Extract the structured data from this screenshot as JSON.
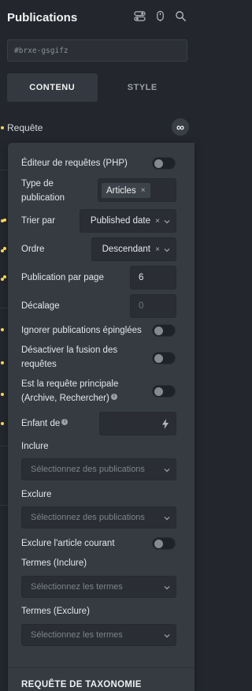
{
  "header": {
    "title": "Publications",
    "icons": [
      "toggle-icon",
      "mouse-pointer-icon",
      "search-icon"
    ]
  },
  "element_id": "#brxe-gsgifz",
  "tabs": [
    {
      "label": "CONTENU",
      "active": true
    },
    {
      "label": "STYLE",
      "active": false
    }
  ],
  "background": {
    "query_label": "Requête",
    "infinity_icon": "∞"
  },
  "panel": {
    "php_editor": {
      "label": "Éditeur de requêtes (PHP)",
      "enabled": false
    },
    "post_type": {
      "label": "Type de publication",
      "tags": [
        "Articles"
      ],
      "remove": "×"
    },
    "order_by": {
      "label": "Trier par",
      "value": "Published date",
      "clear": "×"
    },
    "order": {
      "label": "Ordre",
      "value": "Descendant",
      "clear": "×"
    },
    "per_page": {
      "label": "Publication par page",
      "value": "6"
    },
    "offset": {
      "label": "Décalage",
      "placeholder": "0"
    },
    "ignore_sticky": {
      "label": "Ignorer publications épinglées",
      "enabled": false
    },
    "disable_merge": {
      "label": "Désactiver la fusion des requêtes",
      "enabled": false
    },
    "main_query": {
      "label": "Est la requête principale (Archive, Rechercher)",
      "info": "i",
      "enabled": false
    },
    "child_of": {
      "label": "Enfant de",
      "info": "i"
    },
    "include": {
      "label": "Inclure",
      "placeholder": "Sélectionnez des publications"
    },
    "exclude": {
      "label": "Exclure",
      "placeholder": "Sélectionnez des publications"
    },
    "exclude_current": {
      "label": "Exclure l'article courant",
      "enabled": false
    },
    "terms_include": {
      "label": "Termes (Inclure)",
      "placeholder": "Sélectionnez les termes"
    },
    "terms_exclude": {
      "label": "Termes (Exclure)",
      "placeholder": "Sélectionnez les termes"
    },
    "taxonomy_section": "REQUÊTE DE TAXONOMIE"
  },
  "colors": {
    "background": "#23272d",
    "panel": "#363b42",
    "accent_dot": "#ffd64f"
  }
}
